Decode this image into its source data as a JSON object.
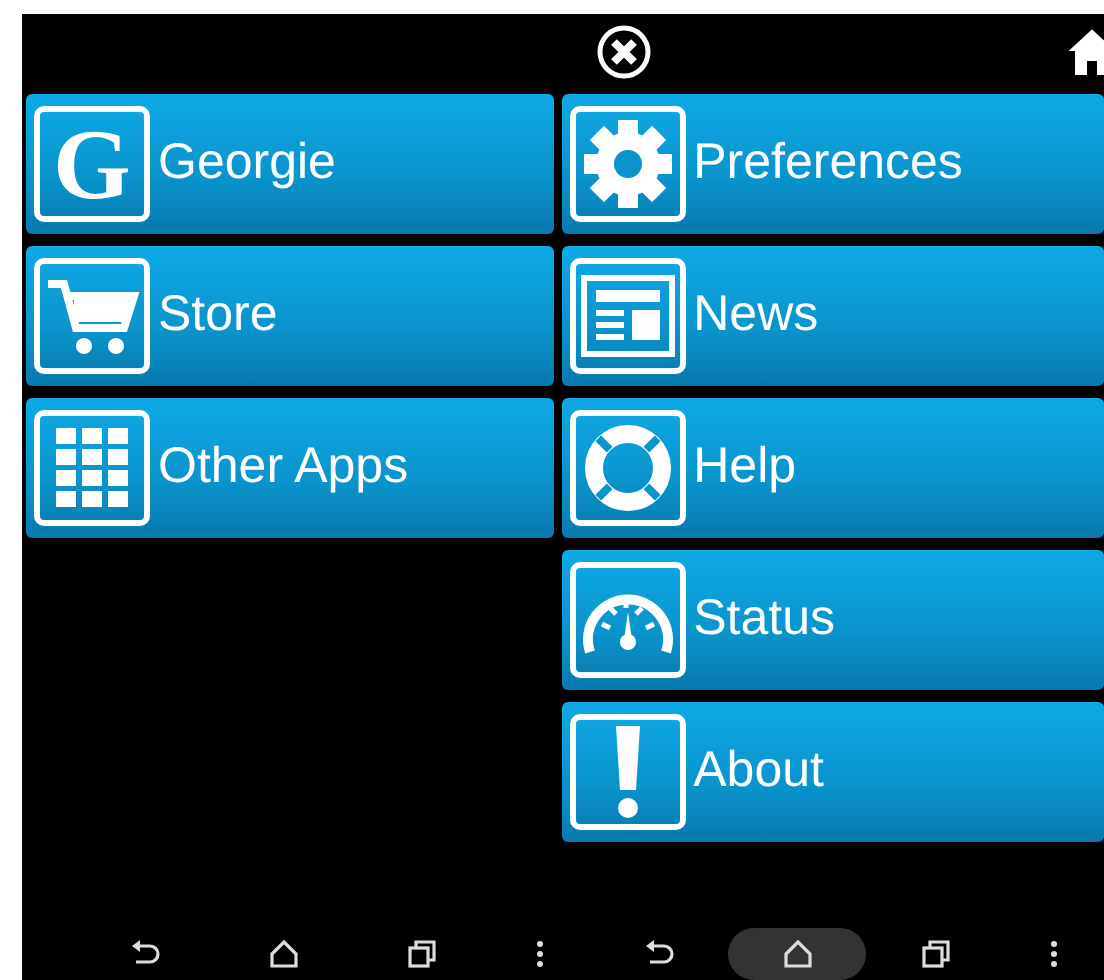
{
  "top_bar": {
    "buttons": [
      {
        "kind": "close"
      },
      {
        "kind": "home"
      }
    ]
  },
  "columns": [
    {
      "tiles": [
        {
          "label": "Georgie",
          "kind": "letter",
          "icon_text": "G"
        },
        {
          "label": "Store",
          "kind": "cart"
        },
        {
          "label": "Other Apps",
          "kind": "grid"
        }
      ]
    },
    {
      "tiles": [
        {
          "label": "Preferences",
          "kind": "gear"
        },
        {
          "label": "News",
          "kind": "newspaper"
        },
        {
          "label": "Help",
          "kind": "lifebuoy"
        },
        {
          "label": "Status",
          "kind": "gauge"
        },
        {
          "label": "About",
          "kind": "exclamation"
        }
      ]
    }
  ],
  "nav_bar": [
    {
      "kind": "back",
      "selected": false
    },
    {
      "kind": "home",
      "selected": false
    },
    {
      "kind": "recents",
      "selected": false
    },
    {
      "kind": "menu",
      "selected": false
    },
    {
      "kind": "back",
      "selected": false
    },
    {
      "kind": "home",
      "selected": true
    },
    {
      "kind": "recents",
      "selected": false
    },
    {
      "kind": "menu",
      "selected": false
    }
  ]
}
